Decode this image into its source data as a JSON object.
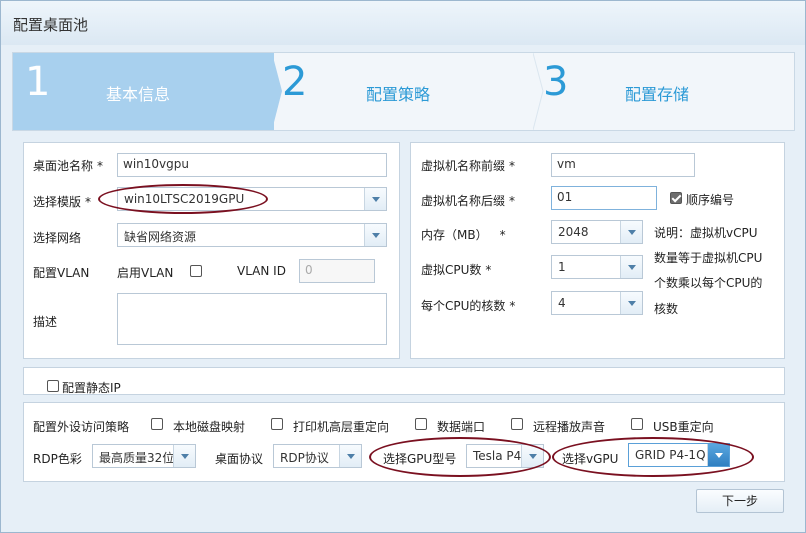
{
  "window": {
    "title": "配置桌面池",
    "close_icon": "close-icon"
  },
  "steps": [
    {
      "num": "1",
      "label": "基本信息",
      "active": true
    },
    {
      "num": "2",
      "label": "配置策略",
      "active": false
    },
    {
      "num": "3",
      "label": "配置存储",
      "active": false
    }
  ],
  "basic": {
    "pool_name_label": "桌面池名称",
    "pool_name_value": "win10vgpu",
    "template_label": "选择模版",
    "template_value": "win10LTSC2019GPU",
    "network_label": "选择网络",
    "network_value": "缺省网络资源",
    "vlan_label": "配置VLAN",
    "enable_vlan_label": "启用VLAN",
    "vlan_id_label": "VLAN ID",
    "vlan_id_value": "0",
    "desc_label": "描述",
    "required_mark": "*"
  },
  "vm": {
    "prefix_label": "虚拟机名称前缀",
    "prefix_value": "vm",
    "suffix_label": "虚拟机名称后缀",
    "suffix_value": "01",
    "seq_label": "顺序编号",
    "memory_label": "内存（MB）",
    "memory_value": "2048",
    "cpu_label": "虚拟CPU数",
    "cpu_value": "1",
    "cores_label": "每个CPU的核数",
    "cores_value": "4",
    "note_lines": [
      "说明：虚拟机vCPU",
      "数量等于虚拟机CPU",
      "个数乘以每个CPU的",
      "核数"
    ]
  },
  "static_ip": {
    "label": "配置静态IP"
  },
  "peripheral": {
    "policy_label": "配置外设访问策略",
    "options": [
      "本地磁盘映射",
      "打印机高层重定向",
      "数据端口",
      "远程播放声音",
      "USB重定向"
    ],
    "rdp_color_label": "RDP色彩",
    "rdp_color_value": "最高质量32位",
    "protocol_label": "桌面协议",
    "protocol_value": "RDP协议",
    "gpu_type_label": "选择GPU型号",
    "gpu_type_value": "Tesla P4",
    "vgpu_label": "选择vGPU",
    "vgpu_value": "GRID P4-1Q"
  },
  "footer": {
    "next_label": "下一步"
  },
  "colors": {
    "accent": "#2c9ad6",
    "active_step": "#a8d0ee",
    "annotation": "#7a1020"
  }
}
